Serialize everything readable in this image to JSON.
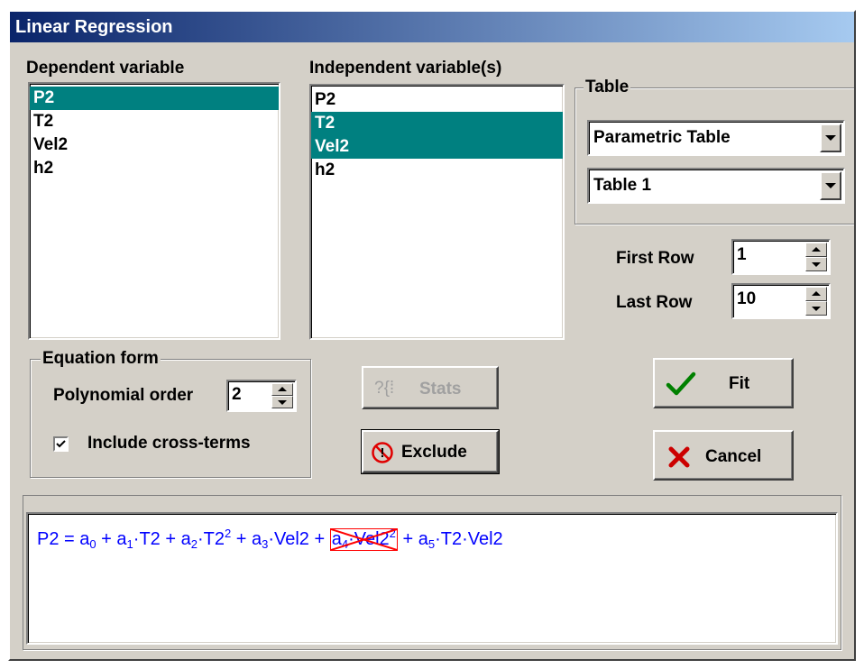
{
  "window": {
    "title": "Linear Regression"
  },
  "dependent": {
    "label": "Dependent variable",
    "items": [
      {
        "label": "P2",
        "selected": true
      },
      {
        "label": "T2",
        "selected": false
      },
      {
        "label": "Vel2",
        "selected": false
      },
      {
        "label": "h2",
        "selected": false
      }
    ]
  },
  "independent": {
    "label": "Independent variable(s)",
    "items": [
      {
        "label": "P2",
        "selected": false
      },
      {
        "label": "T2",
        "selected": true
      },
      {
        "label": "Vel2",
        "selected": true
      },
      {
        "label": "h2",
        "selected": false
      }
    ]
  },
  "table": {
    "group_label": "Table",
    "type_value": "Parametric Table",
    "name_value": "Table 1",
    "first_row_label": "First Row",
    "first_row_value": "1",
    "last_row_label": "Last Row",
    "last_row_value": "10"
  },
  "equation_form": {
    "group_label": "Equation form",
    "poly_label": "Polynomial order",
    "poly_value": "2",
    "cross_terms_label": "Include cross-terms",
    "cross_terms_checked": true
  },
  "buttons": {
    "stats": "Stats",
    "exclude": "Exclude",
    "fit": "Fit",
    "cancel": "Cancel"
  },
  "equation": {
    "lhs": "P2 = a",
    "s0": "0",
    "p1": " + a",
    "s1": "1",
    "p1b": "·T2 + a",
    "s2": "2",
    "p2b": "·T2",
    "sup2a": "2",
    "p3": " + a",
    "s3": "3",
    "p3b": "·Vel2 + ",
    "ex_a": "a",
    "ex_s4": "4",
    "ex_var": "·Vel2",
    "ex_sup": "2",
    "p5": " + a",
    "s5": "5",
    "p5b": "·T2·Vel2"
  },
  "colors": {
    "selection": "#008080",
    "equation_text": "#0000ff",
    "excluded_mark": "#ff0000",
    "check_icon": "#008000",
    "cancel_icon": "#cc0000"
  }
}
